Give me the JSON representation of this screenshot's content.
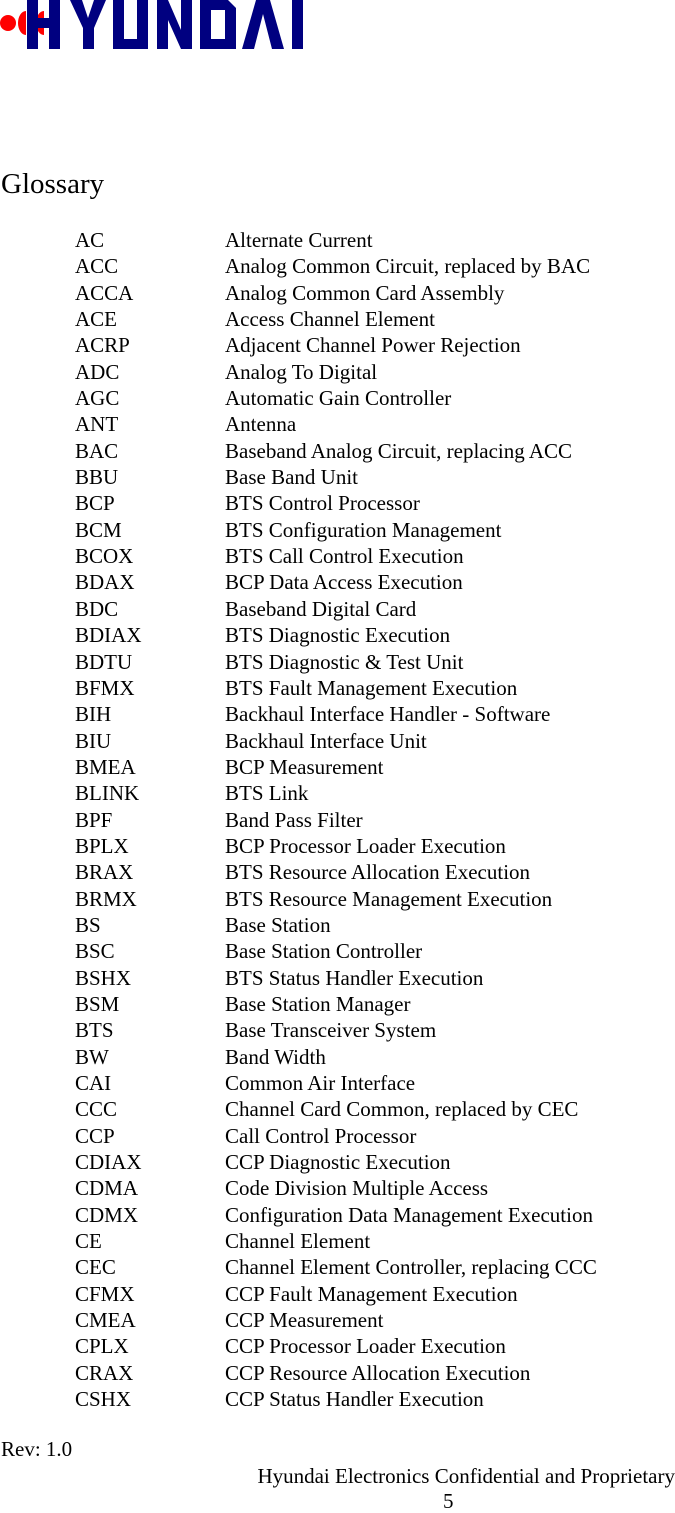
{
  "header": {
    "logo_text": "HYUNDAI",
    "brand_colors": {
      "blue": "#000080",
      "red": "#ff0000"
    }
  },
  "title": "Glossary",
  "glossary": [
    {
      "abbr": "AC",
      "def": "Alternate Current"
    },
    {
      "abbr": "ACC",
      "def": "Analog Common Circuit, replaced by BAC"
    },
    {
      "abbr": "ACCA",
      "def": "Analog Common Card Assembly"
    },
    {
      "abbr": "ACE",
      "def": "Access Channel Element"
    },
    {
      "abbr": "ACRP",
      "def": "Adjacent Channel Power Rejection"
    },
    {
      "abbr": "ADC",
      "def": "Analog To Digital"
    },
    {
      "abbr": "AGC",
      "def": "Automatic Gain Controller"
    },
    {
      "abbr": "ANT",
      "def": "Antenna"
    },
    {
      "abbr": "BAC",
      "def": "Baseband Analog Circuit, replacing ACC"
    },
    {
      "abbr": "BBU",
      "def": "Base Band Unit"
    },
    {
      "abbr": "BCP",
      "def": "BTS Control Processor"
    },
    {
      "abbr": "BCM",
      "def": "BTS Configuration Management"
    },
    {
      "abbr": "BCOX",
      "def": "BTS Call Control Execution"
    },
    {
      "abbr": "BDAX",
      "def": "BCP Data Access Execution"
    },
    {
      "abbr": "BDC",
      "def": "Baseband Digital Card"
    },
    {
      "abbr": "BDIAX",
      "def": "BTS Diagnostic Execution"
    },
    {
      "abbr": "BDTU",
      "def": "BTS Diagnostic & Test Unit"
    },
    {
      "abbr": "BFMX",
      "def": "BTS Fault Management Execution"
    },
    {
      "abbr": "BIH",
      "def": "Backhaul Interface Handler - Software"
    },
    {
      "abbr": "BIU",
      "def": "Backhaul Interface Unit"
    },
    {
      "abbr": "BMEA",
      "def": "BCP Measurement"
    },
    {
      "abbr": "BLINK",
      "def": "BTS Link"
    },
    {
      "abbr": "BPF",
      "def": "Band Pass Filter"
    },
    {
      "abbr": "BPLX",
      "def": "BCP Processor Loader Execution"
    },
    {
      "abbr": "BRAX",
      "def": "BTS Resource Allocation Execution"
    },
    {
      "abbr": "BRMX",
      "def": "BTS Resource Management Execution"
    },
    {
      "abbr": "BS",
      "def": "Base Station"
    },
    {
      "abbr": "BSC",
      "def": "Base Station Controller"
    },
    {
      "abbr": "BSHX",
      "def": "BTS Status Handler Execution"
    },
    {
      "abbr": "BSM",
      "def": "Base Station Manager"
    },
    {
      "abbr": "BTS",
      "def": "Base Transceiver System"
    },
    {
      "abbr": "BW",
      "def": "Band Width"
    },
    {
      "abbr": "CAI",
      "def": "Common Air Interface"
    },
    {
      "abbr": "CCC",
      "def": "Channel Card Common, replaced by CEC"
    },
    {
      "abbr": "CCP",
      "def": "Call Control Processor"
    },
    {
      "abbr": "CDIAX",
      "def": "CCP Diagnostic Execution"
    },
    {
      "abbr": "CDMA",
      "def": "Code Division Multiple Access"
    },
    {
      "abbr": "CDMX",
      "def": "Configuration Data Management Execution"
    },
    {
      "abbr": "CE",
      "def": "Channel Element"
    },
    {
      "abbr": "CEC",
      "def": "Channel Element Controller, replacing CCC"
    },
    {
      "abbr": "CFMX",
      "def": "CCP Fault Management Execution"
    },
    {
      "abbr": "CMEA",
      "def": "CCP Measurement"
    },
    {
      "abbr": "CPLX",
      "def": "CCP Processor Loader Execution"
    },
    {
      "abbr": "CRAX",
      "def": "CCP Resource Allocation Execution"
    },
    {
      "abbr": "CSHX",
      "def": "CCP Status Handler Execution"
    }
  ],
  "footer": {
    "revision": "Rev: 1.0",
    "confidentiality": "Hyundai Electronics Confidential and Proprietary",
    "page_number": "5"
  }
}
